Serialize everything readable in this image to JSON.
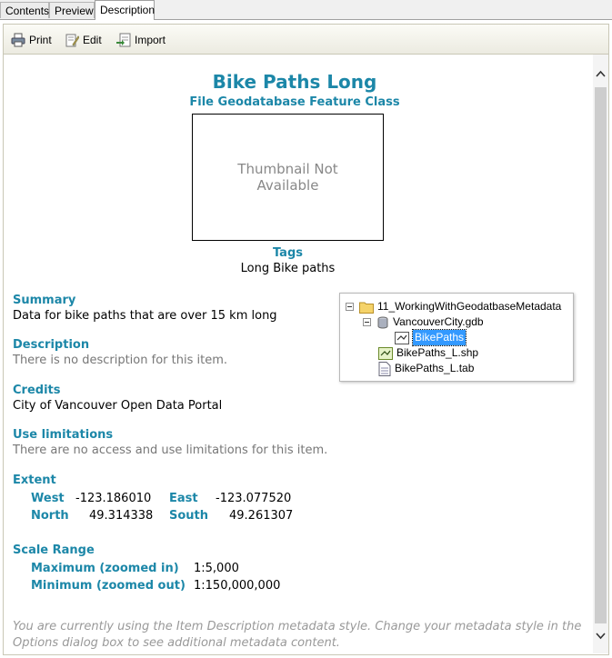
{
  "tabs": [
    {
      "label": "Contents"
    },
    {
      "label": "Preview"
    },
    {
      "label": "Description"
    }
  ],
  "toolbar": {
    "print_label": "Print",
    "edit_label": "Edit",
    "import_label": "Import"
  },
  "item": {
    "title": "Bike Paths Long",
    "type": "File Geodatabase Feature Class",
    "thumbnail_text": "Thumbnail Not Available",
    "tags_heading": "Tags",
    "tags_value": "Long Bike paths"
  },
  "sections": {
    "summary": {
      "heading": "Summary",
      "value": "Data for bike paths that are over 15 km long"
    },
    "description": {
      "heading": "Description",
      "value": "There is no description for this item."
    },
    "credits": {
      "heading": "Credits",
      "value": "City of Vancouver Open Data Portal"
    },
    "use_limitations": {
      "heading": "Use limitations",
      "value": "There are no access and use limitations for this item."
    }
  },
  "extent": {
    "heading": "Extent",
    "west_label": "West",
    "west_value": "-123.186010",
    "east_label": "East",
    "east_value": "-123.077520",
    "north_label": "North",
    "north_value": "49.314338",
    "south_label": "South",
    "south_value": "49.261307"
  },
  "scale_range": {
    "heading": "Scale Range",
    "max_label": "Maximum (zoomed in)",
    "max_value": "1:5,000",
    "min_label": "Minimum (zoomed out)",
    "min_value": "1:150,000,000"
  },
  "footer_note": "You are currently using the Item Description metadata style. Change your metadata style in the Options dialog box to see additional metadata content.",
  "tree": {
    "folder": "11_WorkingWithGeodatbaseMetadata",
    "gdb": "VancouverCity.gdb",
    "feature_class": "BikePaths",
    "shapefile": "BikePaths_L.shp",
    "mapinfo": "BikePaths_L.tab"
  },
  "colors": {
    "accent": "#1c87a8",
    "selection": "#3399ff"
  }
}
